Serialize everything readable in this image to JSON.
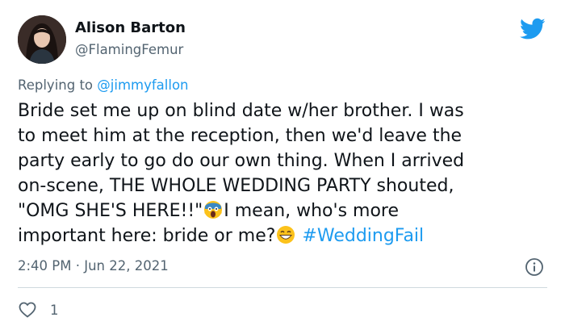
{
  "author": {
    "name": "Alison Barton",
    "handle": "@FlamingFemur"
  },
  "reply": {
    "prefix": "Replying to",
    "mention": "@jimmyfallon"
  },
  "body": {
    "line1": "Bride set me up on blind date w/her brother. I was",
    "line2": "to meet him at the reception, then we'd leave the",
    "line3": "party early to go do our own thing. When I arrived",
    "line4": "on-scene, THE WHOLE WEDDING PARTY shouted,",
    "line5_a": "\"OMG SHE'S HERE!!\"",
    "line5_b": "I mean, who's more",
    "line6_a": "important here: bride or me?",
    "hashtag": "#WeddingFail"
  },
  "meta": {
    "timestamp": "2:40 PM · Jun 22, 2021"
  },
  "stats": {
    "likes": "1"
  },
  "icons": {
    "logo": "twitter-bird-icon",
    "info": "info-icon",
    "like": "heart-icon",
    "emoji1": "screaming-face-emoji",
    "emoji2": "grinning-face-emoji"
  },
  "colors": {
    "accent": "#1d9bf0",
    "text": "#0f1419",
    "secondary": "#536471"
  }
}
